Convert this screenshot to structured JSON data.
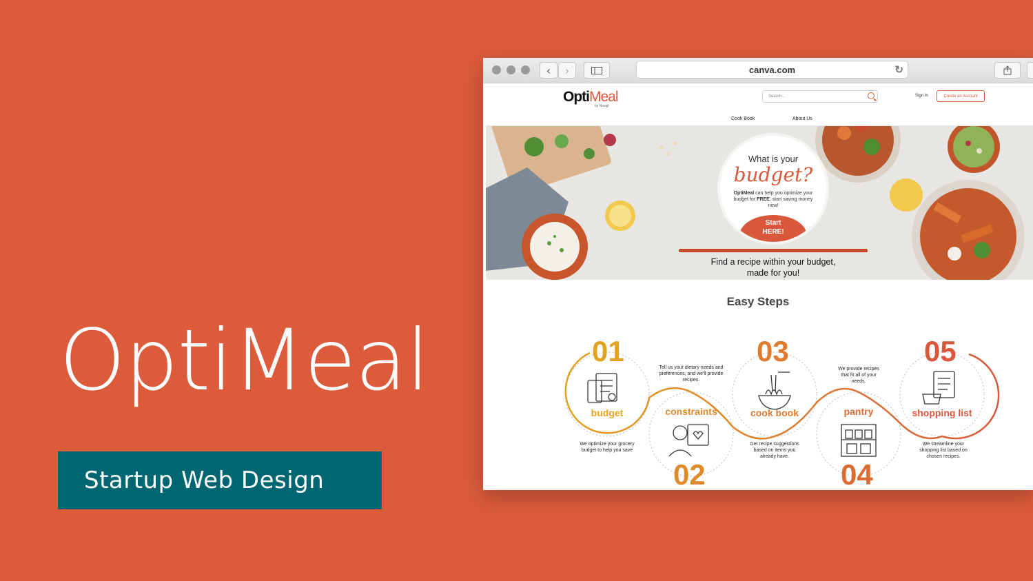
{
  "hero": {
    "title": "OptiMeal",
    "tagline": "Startup Web Design"
  },
  "browser": {
    "url": "canva.com"
  },
  "site": {
    "logo_opti": "Opti",
    "logo_meal": "Meal",
    "logo_sub": "by Novigi",
    "search_placeholder": "Search...",
    "signin": "Sign In",
    "create_account": "Create an Account",
    "nav": [
      "Cook Book",
      "About Us"
    ],
    "budget_q1": "What is your",
    "budget_q2": "budget?",
    "budget_brand": "OptiMeal",
    "budget_body_1": " can help you optimize your budget for ",
    "budget_free": "FREE",
    "budget_body_2": ", start saving money now!",
    "start_line1": "Start",
    "start_line2": "HERE!",
    "caption_line1": "Find a recipe within your budget,",
    "caption_line2": "made for you!",
    "steps_title": "Easy Steps"
  },
  "steps": [
    {
      "num": "01",
      "label": "budget",
      "desc": "We optimize your grocery budget to help you save",
      "color": "#e3a21f"
    },
    {
      "num": "02",
      "label": "constraints",
      "desc": "Tell us your dietary needs and preferences, and we'll provide recipes.",
      "color": "#e08a2b"
    },
    {
      "num": "03",
      "label": "cook book",
      "desc": "Get recipe suggestions based on items you already have.",
      "color": "#e07a2d"
    },
    {
      "num": "04",
      "label": "pantry",
      "desc": "We provide recipes that fit all of your needs.",
      "color": "#dd6a30"
    },
    {
      "num": "05",
      "label": "shopping list",
      "desc": "We streamline your shopping list based on chosen recipes.",
      "color": "#d9573a"
    }
  ],
  "colors": {
    "background": "#dc5b3b",
    "accent": "#d9573a",
    "tagline_bg": "#006672"
  }
}
